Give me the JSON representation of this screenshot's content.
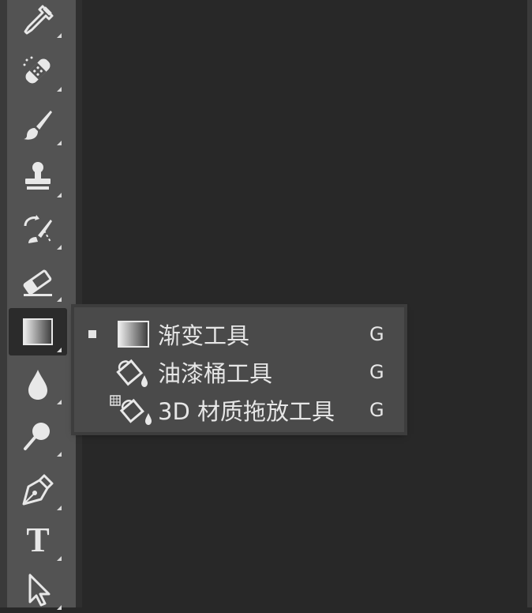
{
  "toolbar": {
    "tools": [
      {
        "name": "eyedropper-icon",
        "active": false
      },
      {
        "name": "healing-brush-icon",
        "active": false
      },
      {
        "name": "brush-icon",
        "active": false
      },
      {
        "name": "clone-stamp-icon",
        "active": false
      },
      {
        "name": "history-brush-icon",
        "active": false
      },
      {
        "name": "eraser-icon",
        "active": false
      },
      {
        "name": "gradient-icon",
        "active": true
      },
      {
        "name": "blur-drop-icon",
        "active": false
      },
      {
        "name": "dodge-icon",
        "active": false
      },
      {
        "name": "pen-icon",
        "active": false
      },
      {
        "name": "text-icon",
        "active": false,
        "glyph": "T"
      },
      {
        "name": "path-selection-icon",
        "active": false
      }
    ]
  },
  "flyout": {
    "items": [
      {
        "label": "渐变工具",
        "shortcut": "G",
        "selected": true,
        "icon": "gradient-icon"
      },
      {
        "label": "油漆桶工具",
        "shortcut": "G",
        "selected": false,
        "icon": "paint-bucket-icon"
      },
      {
        "label": "3D 材质拖放工具",
        "shortcut": "G",
        "selected": false,
        "icon": "3d-material-drop-icon"
      }
    ]
  },
  "colors": {
    "toolbar_bg": "#535353",
    "canvas_bg": "#282828",
    "flyout_bg": "#4a4a4a",
    "icon_color": "#e8e8e8"
  }
}
